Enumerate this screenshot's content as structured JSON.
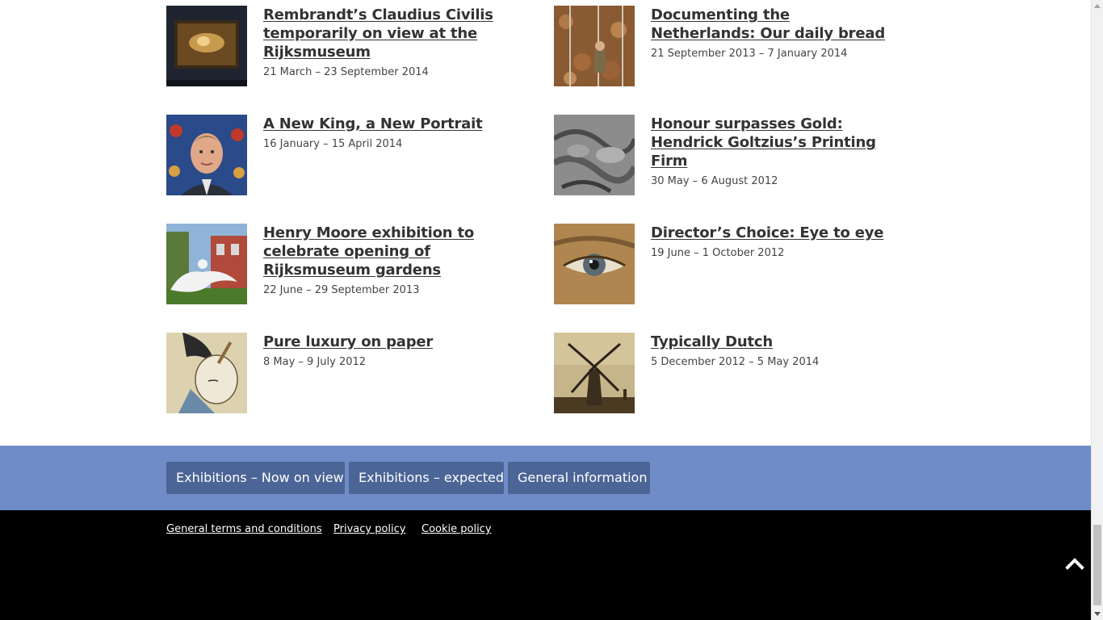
{
  "exhibitions": [
    {
      "title": "Rembrandt’s Claudius Civilis temporarily on view at the Rijksmuseum",
      "dates": "21 March – 23 September 2014",
      "thumbnail": "framed-painting-thumbnail"
    },
    {
      "title": "Documenting the Netherlands: Our daily bread",
      "dates": "21 September 2013 – 7 January 2014",
      "thumbnail": "farmer-photo-thumbnail"
    },
    {
      "title": "A New King, a New Portrait",
      "dates": "16 January – 15 April 2014",
      "thumbnail": "king-portrait-thumbnail"
    },
    {
      "title": "Honour surpasses Gold: Hendrick Goltzius’s Printing Firm",
      "dates": "30 May – 6 August 2012",
      "thumbnail": "engraving-thumbnail"
    },
    {
      "title": "Henry Moore exhibition to celebrate opening of Rijksmuseum gardens",
      "dates": "22 June – 29 September 2013",
      "thumbnail": "sculpture-garden-thumbnail"
    },
    {
      "title": "Director’s Choice: Eye to eye",
      "dates": "19 June – 1 October 2012",
      "thumbnail": "eye-detail-thumbnail"
    },
    {
      "title": "Pure luxury on paper",
      "dates": "8 May – 9 July 2012",
      "thumbnail": "japanese-print-thumbnail"
    },
    {
      "title": "Typically Dutch",
      "dates": "5 December 2012 – 5 May 2014",
      "thumbnail": "windmill-thumbnail"
    }
  ],
  "band": {
    "buttons": [
      {
        "label": "Exhibitions – Now on view"
      },
      {
        "label": "Exhibitions – expected"
      },
      {
        "label": "General information"
      }
    ]
  },
  "footer": {
    "links": [
      {
        "label": "General terms and conditions "
      },
      {
        "label": "Privacy policy "
      },
      {
        "label": "Cookie policy"
      }
    ],
    "back_to_top_icon": "chevron-up-icon"
  },
  "colors": {
    "band_background": "#6f8cc8",
    "band_button": "#4b6596",
    "footer_background": "#000000"
  }
}
